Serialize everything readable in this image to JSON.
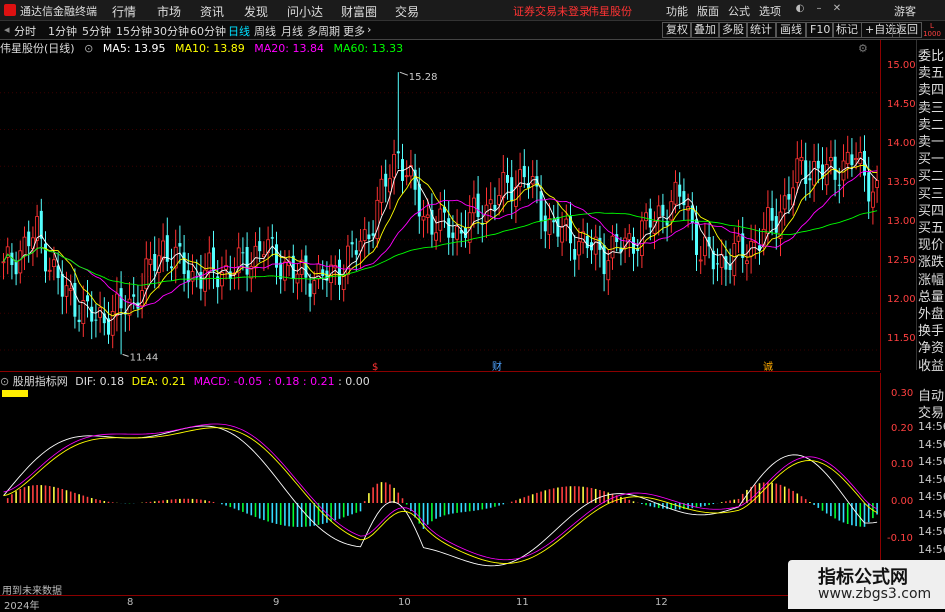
{
  "app": {
    "title": "通达信金融终端",
    "menus": [
      "行情",
      "市场",
      "资讯",
      "发现",
      "问小达",
      "财富圈",
      "交易"
    ],
    "notice": "证券交易未登录",
    "stock_name_header": "伟星股份",
    "right_menus": [
      "功能",
      "版面",
      "公式",
      "选项"
    ],
    "guest": "游客"
  },
  "toolbar": {
    "periods": [
      "分时",
      "1分钟",
      "5分钟",
      "15分钟",
      "30分钟",
      "60分钟",
      "日线",
      "周线",
      "月线",
      "多周期",
      "更多"
    ],
    "active": "日线",
    "right_buttons": [
      "复权",
      "叠加",
      "多股",
      "统计",
      "画线",
      "F10",
      "标记",
      "+自选",
      "返回"
    ]
  },
  "main_chart": {
    "stock": "伟星股份(日线)",
    "ma": [
      {
        "label": "MA5: 13.95",
        "color": "#ffffff"
      },
      {
        "label": "MA10: 13.89",
        "color": "#ffff00"
      },
      {
        "label": "MA20: 13.84",
        "color": "#ff00ff"
      },
      {
        "label": "MA60: 13.33",
        "color": "#00ff00"
      }
    ],
    "price_ticks": [
      "15.00",
      "14.50",
      "14.00",
      "13.50",
      "13.00",
      "12.50",
      "12.00",
      "11.50"
    ],
    "high_label": "15.28",
    "low_label": "11.44",
    "markers": [
      "$",
      "财",
      "诚"
    ]
  },
  "side_panel": [
    "委比",
    "卖五",
    "卖四",
    "卖三",
    "卖二",
    "卖一",
    "买一",
    "买二",
    "买三",
    "买四",
    "买五",
    "现价",
    "涨跌",
    "涨幅",
    "总量",
    "外盘",
    "换手",
    "净资",
    "收益"
  ],
  "side_panel_bottom": [
    "自动",
    "交易"
  ],
  "macd": {
    "name": "股朋指标网",
    "dif": "DIF: 0.18",
    "dea": "DEA: 0.21",
    "macd": "MACD: -0.05",
    "extra": [
      ": 0.18",
      ": 0.21",
      ": 0.00"
    ],
    "ticks": [
      "0.30",
      "0.20",
      "0.10",
      "0.00",
      "-0.10"
    ],
    "footnote": "用到未来数据"
  },
  "time_list": [
    "14:56",
    "14:56",
    "14:56",
    "14:56",
    "14:56",
    "14:56",
    "14:56",
    "14:56",
    "14:56",
    "14:56",
    "14:56"
  ],
  "dates": [
    "2024年",
    "8",
    "9",
    "10",
    "11",
    "12"
  ],
  "watermark": {
    "line1": "指标公式网",
    "line2": "www.zbgs3.com"
  }
}
